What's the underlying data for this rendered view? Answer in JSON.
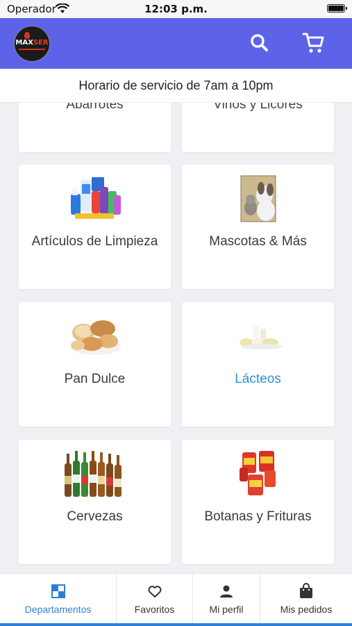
{
  "status_bar": {
    "carrier": "Operador",
    "time": "12:03 p.m."
  },
  "header": {
    "logo_text_left": "MAX",
    "logo_text_right": "SER",
    "accent_color": "#5c63e8"
  },
  "banner": {
    "text": "Horario de servicio de 7am a 10pm"
  },
  "departments": [
    {
      "label": "Abarrotes",
      "icon": "groceries-image"
    },
    {
      "label": "Vinos y Licores",
      "icon": "wine-image"
    },
    {
      "label": "Artículos de Limpieza",
      "icon": "cleaning-products-image"
    },
    {
      "label": "Mascotas & Más",
      "icon": "pets-image"
    },
    {
      "label": "Pan Dulce",
      "icon": "sweet-bread-image"
    },
    {
      "label": "Lácteos",
      "icon": "dairy-image",
      "selected": true
    },
    {
      "label": "Cervezas",
      "icon": "beer-bottles-image"
    },
    {
      "label": "Botanas y Frituras",
      "icon": "snacks-image"
    }
  ],
  "tabs": [
    {
      "label": "Departamentos",
      "icon": "grid-icon",
      "active": true
    },
    {
      "label": "Favoritos",
      "icon": "heart-icon"
    },
    {
      "label": "Mi perfil",
      "icon": "person-icon"
    },
    {
      "label": "Mis pedidos",
      "icon": "shopping-bag-icon"
    }
  ],
  "colors": {
    "appbar": "#5c63e8",
    "active_blue": "#2c7fd8"
  }
}
